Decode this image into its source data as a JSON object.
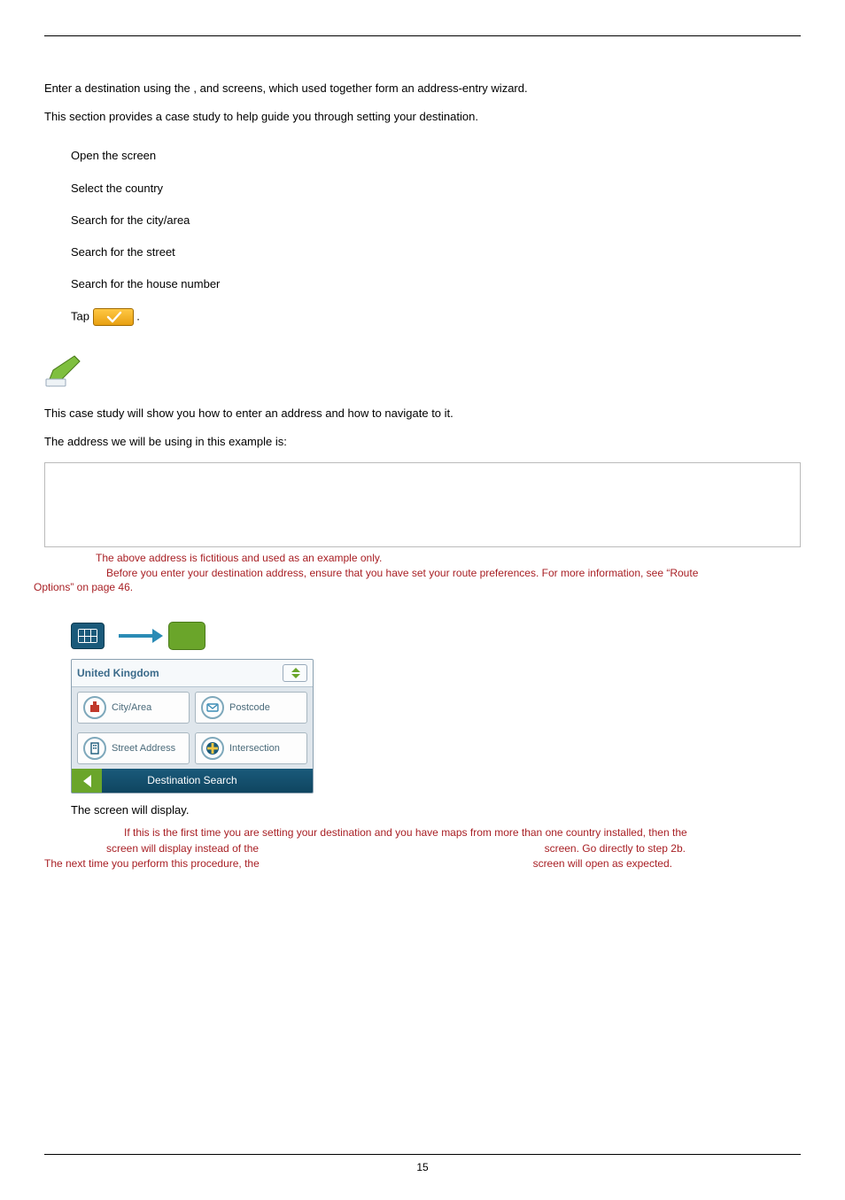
{
  "intro": {
    "line1_a": "Enter a destination using the ",
    "line1_b": ", ",
    "line1_c": "and ",
    "line1_d": " screens, which used together form an address-entry wizard.",
    "line2": "This section provides a case study to help guide you through setting your destination."
  },
  "steps": {
    "s1_a": "Open the ",
    "s1_b": " screen",
    "s2": "Select the country",
    "s3": "Search for the city/area",
    "s4": "Search for the street",
    "s5": "Search for the house number",
    "s6_a": "Tap ",
    "s6_b": "."
  },
  "body": {
    "p1": "This case study will show you how to enter an address and how to navigate to it.",
    "p2": "The address we will be using in this example is:"
  },
  "note": {
    "l1": "The above address is fictitious and used as an example only.",
    "l2a": "Before you enter your destination address, ensure that you have set your route preferences. For more information, see “Route ",
    "l2b": "Options” on page 46."
  },
  "panel": {
    "country": "United Kingdom",
    "cityarea": "City/Area",
    "postcode": "Postcode",
    "street": "Street Address",
    "intersection": "Intersection",
    "footer": "Destination Search"
  },
  "after": {
    "a": "The ",
    "b": " screen will display."
  },
  "red": {
    "l1": "If this is the first time you are setting your destination and you have maps from more than one country installed, then the ",
    "l2a": " screen will display instead of the ",
    "l2b": " screen. Go directly to step 2b.",
    "l3a": "The next time you perform this procedure, the ",
    "l3b": " screen will open as expected."
  },
  "page_number": "15"
}
